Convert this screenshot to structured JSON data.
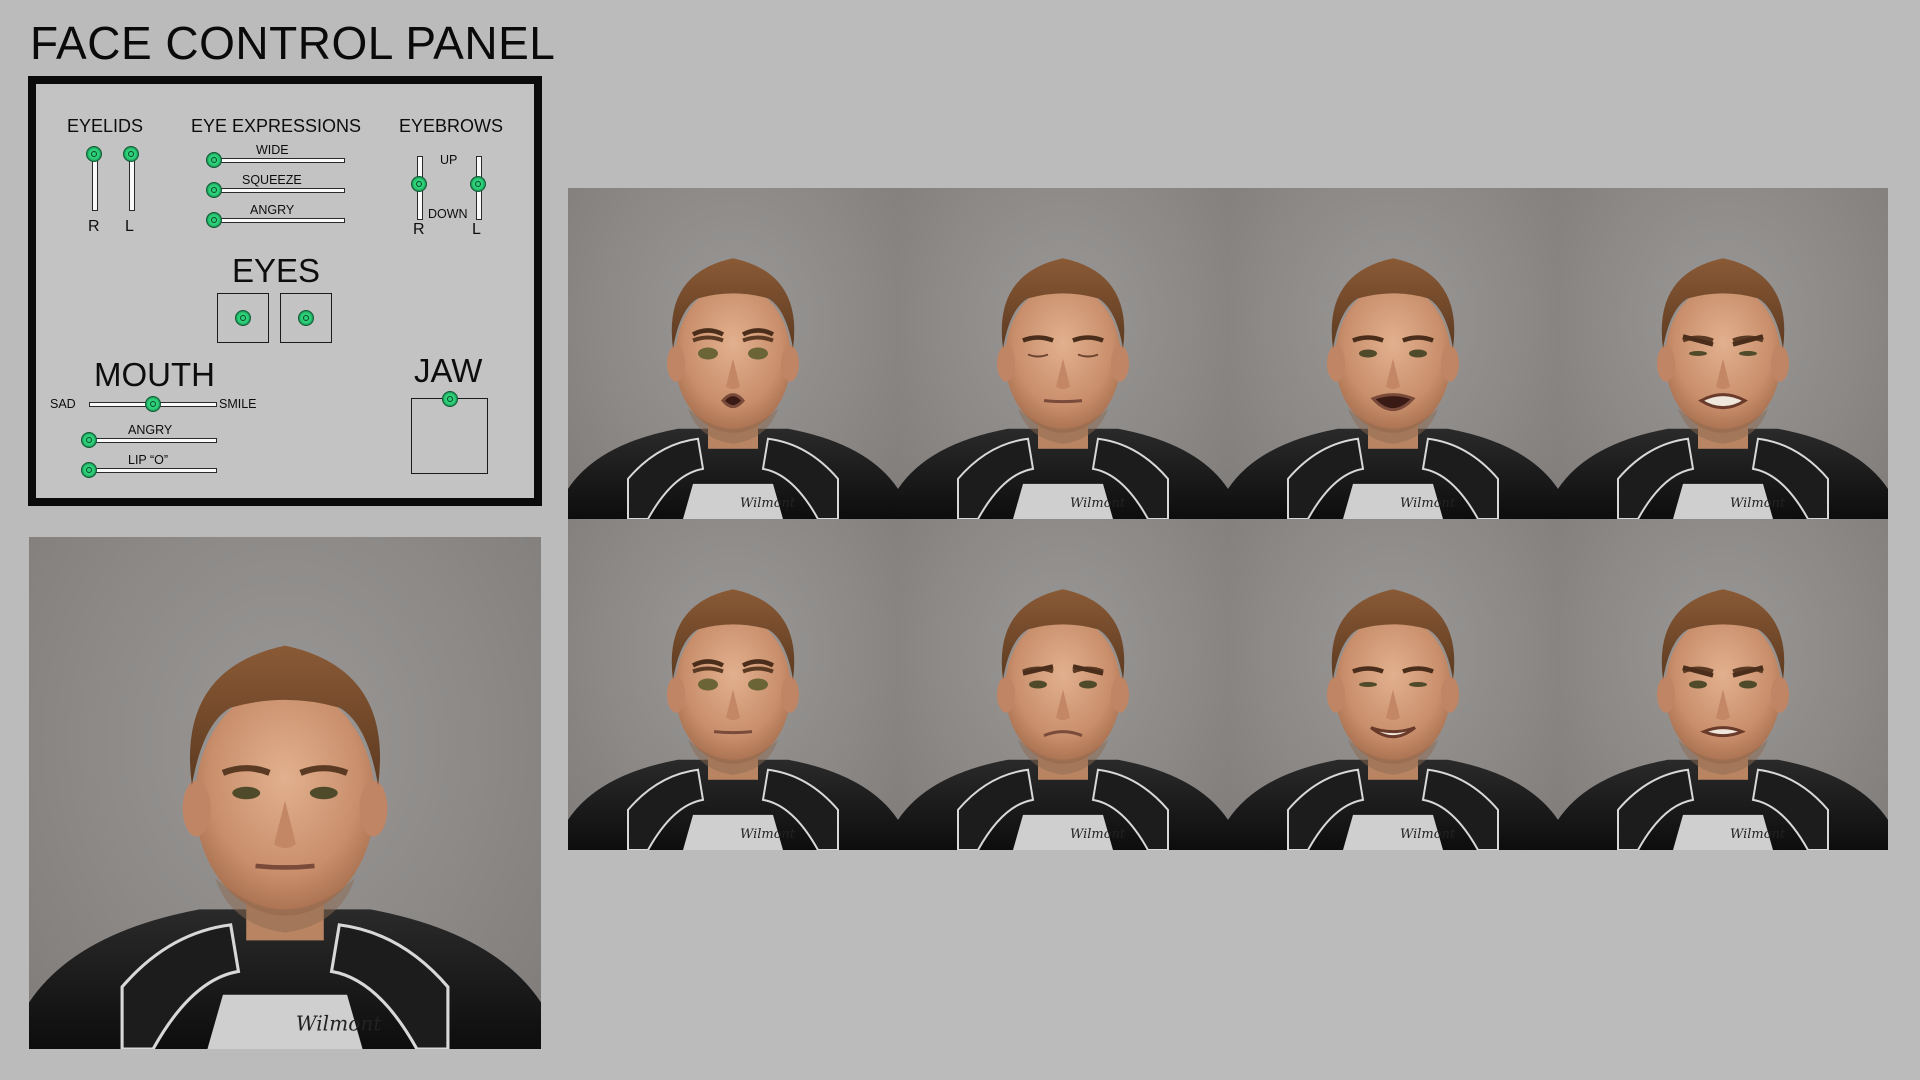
{
  "title": "FACE CONTROL PANEL",
  "panel": {
    "eyelids": {
      "label": "EYELIDS",
      "right": "R",
      "left": "L"
    },
    "eye_expressions": {
      "label": "EYE EXPRESSIONS",
      "wide": "WIDE",
      "squeeze": "SQUEEZE",
      "angry": "ANGRY"
    },
    "eyebrows": {
      "label": "EYEBROWS",
      "up": "UP",
      "down": "DOWN",
      "right": "R",
      "left": "L"
    },
    "eyes": {
      "label": "EYES"
    },
    "mouth": {
      "label": "MOUTH",
      "sad": "SAD",
      "smile": "SMILE",
      "angry": "ANGRY",
      "lip_o": "LIP “O”"
    },
    "jaw": {
      "label": "JAW"
    }
  },
  "colors": {
    "background": "#bbbbbb",
    "panel": "#c3c3c3",
    "knob": "#2ed17a",
    "frame": "#0b0b0b"
  },
  "slider_values": {
    "eyelid_r": 1.0,
    "eyelid_l": 1.0,
    "eye_wide": 0.0,
    "eye_squeeze": 0.0,
    "eye_angry": 0.0,
    "brow_r": 0.5,
    "brow_l": 0.5,
    "mouth_sad_smile": 0.5,
    "mouth_angry": 0.0,
    "mouth_lip_o": 0.0
  },
  "expressions": [
    {
      "row": 0,
      "col": 0,
      "eyes": "wide",
      "mouth": "o",
      "brows": "raised"
    },
    {
      "row": 0,
      "col": 1,
      "eyes": "closed",
      "mouth": "neutral",
      "brows": "neutral"
    },
    {
      "row": 0,
      "col": 2,
      "eyes": "normal",
      "mouth": "open",
      "brows": "neutral"
    },
    {
      "row": 0,
      "col": 3,
      "eyes": "squint",
      "mouth": "snarl",
      "brows": "angry"
    },
    {
      "row": 1,
      "col": 0,
      "eyes": "wide",
      "mouth": "neutral",
      "brows": "raised"
    },
    {
      "row": 1,
      "col": 1,
      "eyes": "normal",
      "mouth": "sad",
      "brows": "sad"
    },
    {
      "row": 1,
      "col": 2,
      "eyes": "squint",
      "mouth": "smile",
      "brows": "neutral"
    },
    {
      "row": 1,
      "col": 3,
      "eyes": "normal",
      "mouth": "teeth",
      "brows": "angry"
    }
  ],
  "shirt_logo": "Wilmont"
}
